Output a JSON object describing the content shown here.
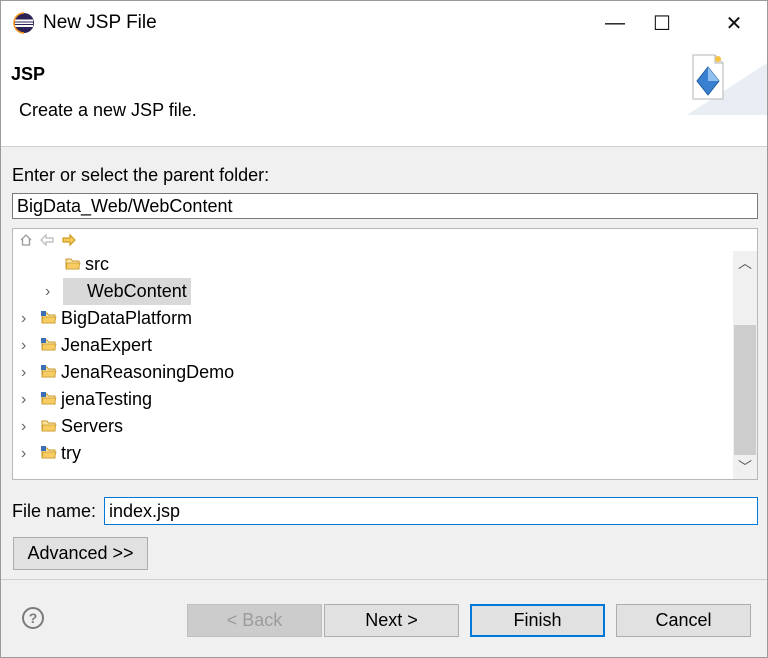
{
  "window": {
    "title": "New JSP File",
    "controls": {
      "minimize": "—",
      "maximize": "☐",
      "close": "✕"
    }
  },
  "banner": {
    "title": "JSP",
    "description": "Create a new JSP file."
  },
  "folder": {
    "label": "Enter or select the parent folder:",
    "value": "BigData_Web/WebContent"
  },
  "tree": {
    "rows": [
      {
        "label": "src",
        "expandable": false,
        "selected": false,
        "icon": "folder-icon"
      },
      {
        "label": "WebContent",
        "expandable": true,
        "selected": true,
        "icon": "folder-icon"
      },
      {
        "label": "BigDataPlatform",
        "expandable": true,
        "selected": false,
        "icon": "project-icon"
      },
      {
        "label": "JenaExpert",
        "expandable": true,
        "selected": false,
        "icon": "project-icon"
      },
      {
        "label": "JenaReasoningDemo",
        "expandable": true,
        "selected": false,
        "icon": "project-icon"
      },
      {
        "label": "jenaTesting",
        "expandable": true,
        "selected": false,
        "icon": "project-icon"
      },
      {
        "label": "Servers",
        "expandable": true,
        "selected": false,
        "icon": "folder-icon"
      },
      {
        "label": "try",
        "expandable": true,
        "selected": false,
        "icon": "project-icon"
      }
    ]
  },
  "file": {
    "label": "File name:",
    "value": "index.jsp"
  },
  "buttons": {
    "advanced": "Advanced >>",
    "back": "< Back",
    "next": "Next >",
    "finish": "Finish",
    "cancel": "Cancel"
  },
  "help_glyph": "?",
  "colors": {
    "accent": "#0078d7",
    "selection": "#d9d9d9"
  }
}
